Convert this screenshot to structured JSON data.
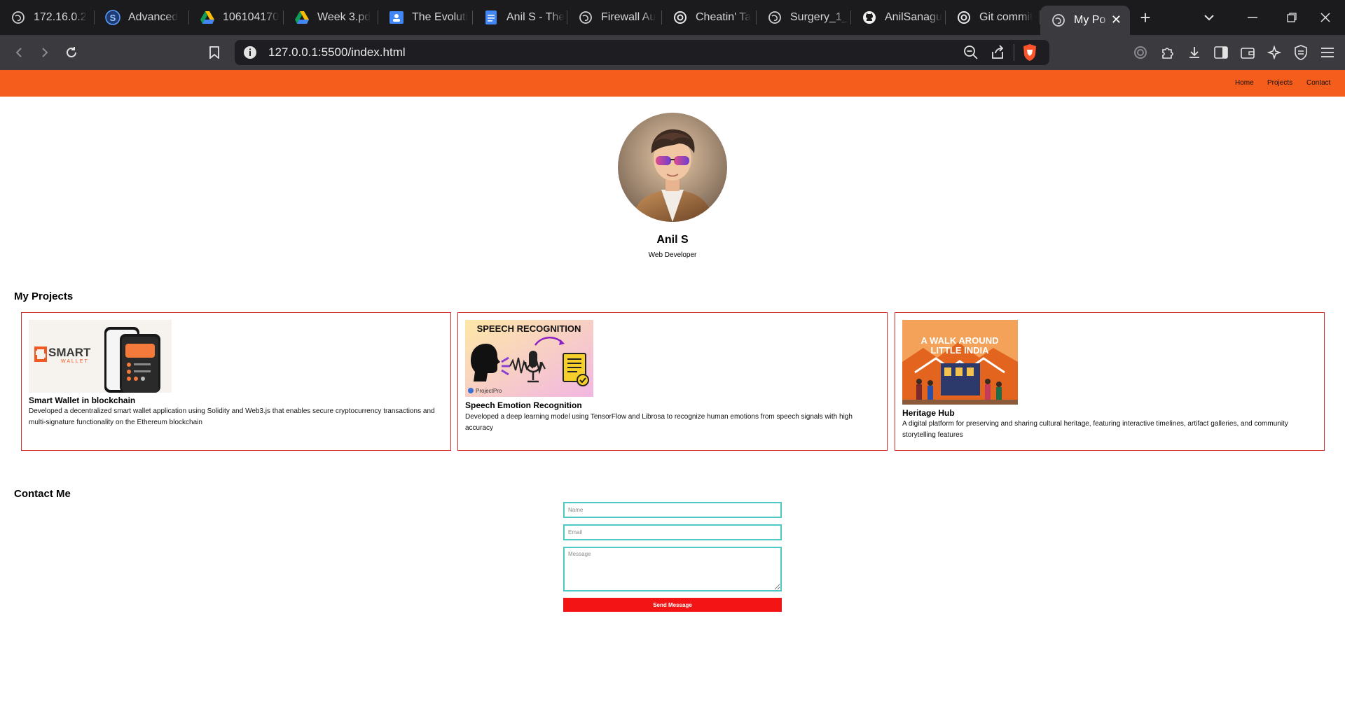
{
  "browser": {
    "tabs": [
      {
        "title": "172.16.0.2",
        "icon": "globe-icon"
      },
      {
        "title": "Advanced",
        "icon": "s-logo-icon"
      },
      {
        "title": "106104170",
        "icon": "google-drive-icon"
      },
      {
        "title": "Week 3.pd",
        "icon": "google-drive-icon"
      },
      {
        "title": "The Evoluti",
        "icon": "google-classroom-icon"
      },
      {
        "title": "Anil S - The",
        "icon": "google-docs-icon"
      },
      {
        "title": "Firewall Au",
        "icon": "globe-icon"
      },
      {
        "title": "Cheatin' Ta",
        "icon": "chatgpt-icon"
      },
      {
        "title": "Surgery_1_",
        "icon": "globe-icon"
      },
      {
        "title": "AnilSanagu",
        "icon": "github-icon"
      },
      {
        "title": "Git commit",
        "icon": "chatgpt-icon"
      },
      {
        "title": "My Po",
        "icon": "globe-icon",
        "active": true
      }
    ],
    "address": "127.0.0.1:5500/index.html"
  },
  "site": {
    "nav": {
      "home": "Home",
      "projects": "Projects",
      "contact": "Contact"
    },
    "profile": {
      "name": "Anil S",
      "role": "Web Developer"
    },
    "projects_heading": "My Projects",
    "projects": [
      {
        "title": "Smart Wallet in blockchain",
        "description": "Developed a decentralized smart wallet application using Solidity and Web3.js that enables secure cryptocurrency transactions and multi-signature functionality on the Ethereum blockchain",
        "image": {
          "logo_top": "SMART",
          "logo_bottom": "WALLET"
        }
      },
      {
        "title": "Speech Emotion Recognition",
        "description": "Developed a deep learning model using TensorFlow and Librosa to recognize human emotions from speech signals with high accuracy",
        "image": {
          "banner": "SPEECH RECOGNITION",
          "credit": "ProjectPro"
        }
      },
      {
        "title": "Heritage Hub",
        "description": "A digital platform for preserving and sharing cultural heritage, featuring interactive timelines, artifact galleries, and community storytelling features",
        "image": {
          "line1": "A WALK AROUND",
          "line2": "LITTLE INDIA"
        }
      }
    ],
    "contact_heading": "Contact Me",
    "contact_form": {
      "name_placeholder": "Name",
      "email_placeholder": "Email",
      "message_placeholder": "Message",
      "submit_label": "Send Message"
    }
  },
  "colors": {
    "nav_bar": "#f55d1d",
    "card_border": "#d62b2b",
    "input_border": "#4fc9c3",
    "send_button": "#f31416"
  }
}
